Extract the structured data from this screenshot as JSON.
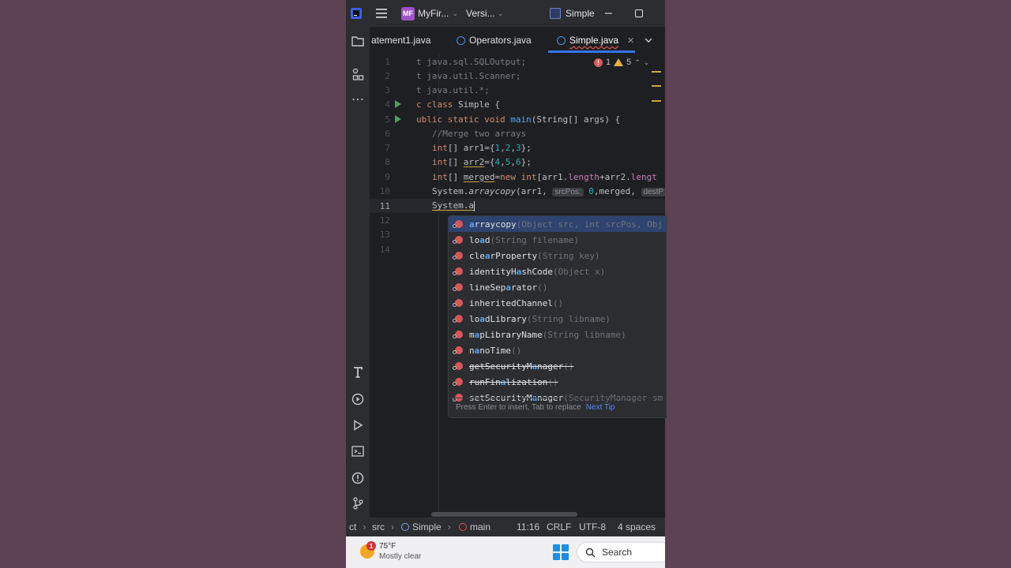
{
  "titlebar": {
    "project_badge": "MF",
    "project_name": "MyFir...",
    "vcs_label": "Versi...",
    "run_config": "Simple"
  },
  "tabs": [
    {
      "label": "atement1.java"
    },
    {
      "label": "Operators.java"
    },
    {
      "label": "Simple.java",
      "active": true
    }
  ],
  "inspections": {
    "errors": "1",
    "warnings": "5"
  },
  "editor": {
    "lines": [
      {
        "n": "1",
        "text": "t java.sql.SQLOutput;"
      },
      {
        "n": "2",
        "text": "t java.util.Scanner;"
      },
      {
        "n": "3",
        "text": "t java.util.*;"
      },
      {
        "n": "4",
        "text": "c class Simple {"
      },
      {
        "n": "5",
        "text": "ublic static void main(String[] args) {"
      },
      {
        "n": "6",
        "text": "//Merge two arrays"
      },
      {
        "n": "7",
        "text": "int[] arr1={1,2,3};"
      },
      {
        "n": "8",
        "text": "int[] arr2={4,5,6};"
      },
      {
        "n": "9",
        "text": "int[] merged=new int[arr1.length+arr2.length"
      },
      {
        "n": "10",
        "text": "System.arraycopy(arr1, srcPos: 0,merged, destPos:"
      },
      {
        "n": "11",
        "text": "System.a"
      },
      {
        "n": "12",
        "text": ""
      },
      {
        "n": "13",
        "text": ""
      },
      {
        "n": "14",
        "text": ""
      }
    ],
    "tokens": {
      "l1_kw": "t",
      "l1_rest": " java.sql.SQLOutput;",
      "l2_kw": "t",
      "l2_rest": " java.util.Scanner;",
      "l3_kw": "t",
      "l3_rest": " java.util.*;",
      "l4_a": "c class",
      "l4_b": " Simple {",
      "l5_a": "ublic static void ",
      "l5_fn": "main",
      "l5_b": "(String[] args) {",
      "l6": "//Merge two arrays",
      "l7_kw": "int",
      "l7_a": "[] arr1={",
      "l7_n1": "1",
      "l7_c1": ",",
      "l7_n2": "2",
      "l7_c2": ",",
      "l7_n3": "3",
      "l7_b": "};",
      "l8_kw": "int",
      "l8_a": "[] ",
      "l8_var": "arr2",
      "l8_b": "={",
      "l8_n1": "4",
      "l8_c1": ",",
      "l8_n2": "5",
      "l8_c2": ",",
      "l8_n3": "6",
      "l8_end": "};",
      "l9_kw": "int",
      "l9_a": "[] ",
      "l9_var": "merged",
      "l9_b": "=",
      "l9_kw2": "new int",
      "l9_c": "[arr1.",
      "l9_f1": "length",
      "l9_d": "+arr2.",
      "l9_f2": "lengt",
      "l10_a": "System.",
      "l10_fn": "arraycopy",
      "l10_b": "(arr1, ",
      "l10_h1": "srcPos:",
      "l10_n": "0",
      "l10_c": ",merged, ",
      "l10_h2": "destP",
      "l11": "System.a"
    }
  },
  "completion": {
    "items": [
      {
        "pre": "",
        "hl": "a",
        "post": "rraycopy",
        "sig": "(Object src, int srcPos, Obj",
        "selected": true
      },
      {
        "pre": "lo",
        "hl": "a",
        "post": "d",
        "sig": "(String filename)"
      },
      {
        "pre": "cle",
        "hl": "a",
        "post": "rProperty",
        "sig": "(String key)"
      },
      {
        "pre": "identityH",
        "hl": "a",
        "post": "shCode",
        "sig": "(Object x)"
      },
      {
        "pre": "lineSep",
        "hl": "a",
        "post": "rator",
        "sig": "()"
      },
      {
        "pre": "inherited",
        "hl": "",
        "post": "Channel",
        "sig": "()"
      },
      {
        "pre": "lo",
        "hl": "a",
        "post": "dLibrary",
        "sig": "(String libname)"
      },
      {
        "pre": "m",
        "hl": "a",
        "post": "pLibraryName",
        "sig": "(String libname)"
      },
      {
        "pre": "n",
        "hl": "a",
        "post": "noTime",
        "sig": "()"
      },
      {
        "pre": "getSecurityM",
        "hl": "a",
        "post": "nager",
        "sig": "()",
        "deprecated": true
      },
      {
        "pre": "runFin",
        "hl": "a",
        "post": "lization",
        "sig": "()",
        "deprecated": true
      },
      {
        "pre": "setSecurityM",
        "hl": "a",
        "post": "nager",
        "sig": "(SecurityManager sm",
        "deprecated": true
      }
    ],
    "footer_hint": "Press Enter to insert, Tab to replace",
    "footer_link": "Next Tip"
  },
  "statusbar": {
    "crumb_start": "ct",
    "crumb_src": "src",
    "crumb_class": "Simple",
    "crumb_method": "main",
    "position": "11:16",
    "line_sep": "CRLF",
    "encoding": "UTF-8",
    "indent": "4 spaces"
  },
  "taskbar": {
    "weather_badge": "1",
    "temperature": "75°F",
    "condition": "Mostly clear",
    "search": "Search"
  },
  "colors": {
    "background": "#5c4252",
    "editor_bg": "#1e1f22",
    "accent": "#3574f0",
    "error": "#db5c5c",
    "warning": "#e0b04a"
  }
}
